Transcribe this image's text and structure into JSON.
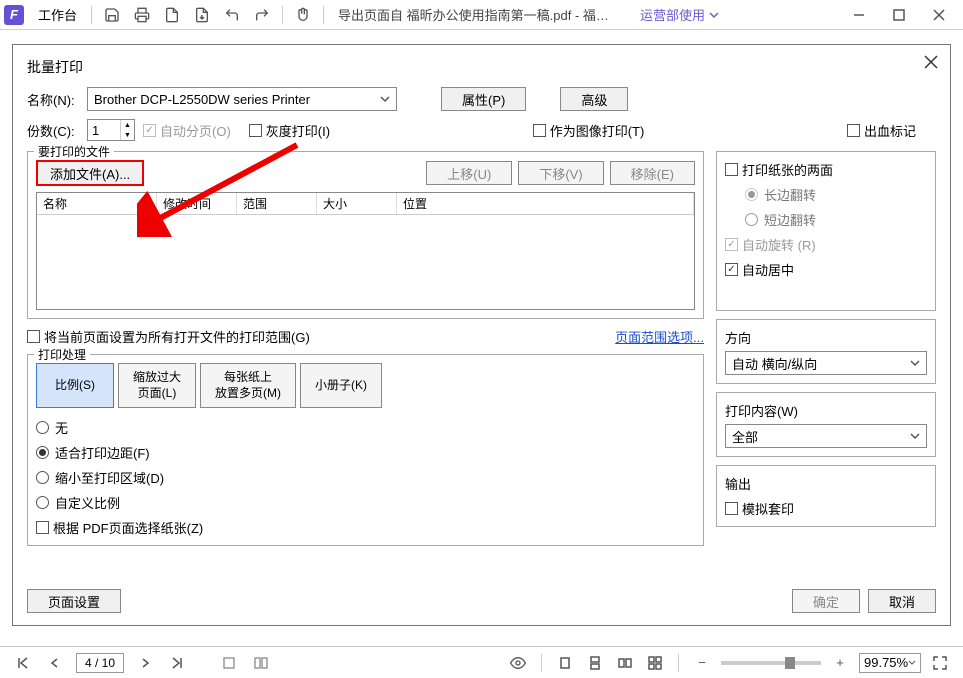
{
  "titlebar": {
    "workspace": "工作台",
    "doc": "导出页面自 福昕办公使用指南第一稿.pdf - 福昕办...",
    "share": "运营部使用"
  },
  "dialog": {
    "title": "批量打印",
    "name_lbl": "名称(N):",
    "printer": "Brother DCP-L2550DW series Printer",
    "properties": "属性(P)",
    "advanced": "高级",
    "copies_lbl": "份数(C):",
    "copies": "1",
    "collate": "自动分页(O)",
    "grayscale": "灰度打印(I)",
    "as_image": "作为图像打印(T)",
    "bleed": "出血标记",
    "files_group": "要打印的文件",
    "add_file": "添加文件(A)...",
    "move_up": "上移(U)",
    "move_down": "下移(V)",
    "remove": "移除(E)",
    "cols": {
      "name": "名称",
      "mtime": "修改时间",
      "range": "范围",
      "size": "大小",
      "pos": "位置"
    },
    "apply_range": "将当前页面设置为所有打开文件的打印范围(G)",
    "range_link": "页面范围选项...",
    "handle_group": "打印处理",
    "tabs": {
      "scale": "比例(S)",
      "enlarge": "缩放过大\n页面(L)",
      "multi": "每张纸上\n放置多页(M)",
      "booklet": "小册子(K)"
    },
    "radios": {
      "none": "无",
      "fit": "适合打印边距(F)",
      "shrink": "缩小至打印区域(D)",
      "custom": "自定义比例"
    },
    "paper_chk": "根据 PDF页面选择纸张(Z)",
    "page_setup": "页面设置",
    "ok": "确定",
    "cancel": "取消",
    "paper": {
      "both_sides": "打印纸张的两面",
      "long_edge": "长边翻转",
      "short_edge": "短边翻转",
      "auto_rotate": "自动旋转 (R)",
      "auto_center": "自动居中"
    },
    "orient": {
      "label": "方向",
      "value": "自动 横向/纵向"
    },
    "content": {
      "label": "打印内容(W)",
      "value": "全部"
    },
    "output": {
      "label": "输出",
      "simulate": "模拟套印"
    }
  },
  "statusbar": {
    "page": "4 / 10",
    "zoom": "99.75%"
  }
}
